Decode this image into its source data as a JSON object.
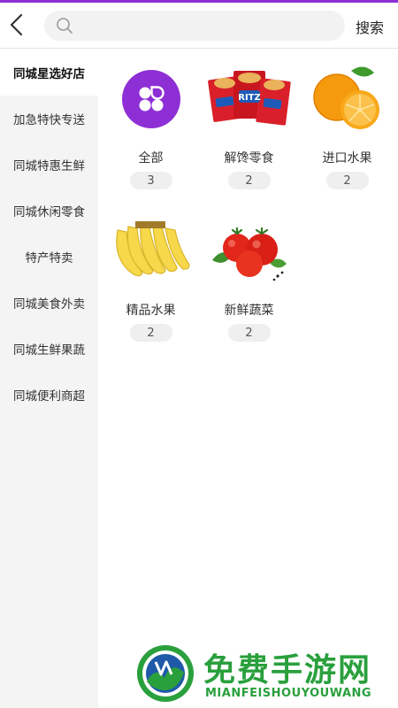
{
  "header": {
    "search_placeholder": "",
    "search_button": "搜索",
    "icons": {
      "back": "back-arrow-icon",
      "search": "search-icon"
    }
  },
  "sidebar": {
    "items": [
      {
        "label": "同城星选好店",
        "active": true
      },
      {
        "label": "加急特快专送",
        "active": false
      },
      {
        "label": "同城特惠生鲜",
        "active": false
      },
      {
        "label": "同城休闲零食",
        "active": false
      },
      {
        "label": "特产特卖",
        "active": false
      },
      {
        "label": "同城美食外卖",
        "active": false
      },
      {
        "label": "同城生鲜果蔬",
        "active": false
      },
      {
        "label": "同城便利商超",
        "active": false
      }
    ]
  },
  "categories": [
    {
      "label": "全部",
      "count": "3",
      "icon": "all-category-icon"
    },
    {
      "label": "解馋零食",
      "count": "2",
      "icon": "snack-crackers-image"
    },
    {
      "label": "进口水果",
      "count": "2",
      "icon": "orange-image"
    },
    {
      "label": "精品水果",
      "count": "2",
      "icon": "banana-image"
    },
    {
      "label": "新鲜蔬菜",
      "count": "2",
      "icon": "tomato-image"
    }
  ],
  "watermark": {
    "title": "免费手游网",
    "subtitle": "MIANFEISHOUYOUWANG"
  },
  "colors": {
    "accent": "#8e2fd6",
    "sidebar_bg": "#f4f4f4",
    "watermark": "#2aa03d"
  }
}
